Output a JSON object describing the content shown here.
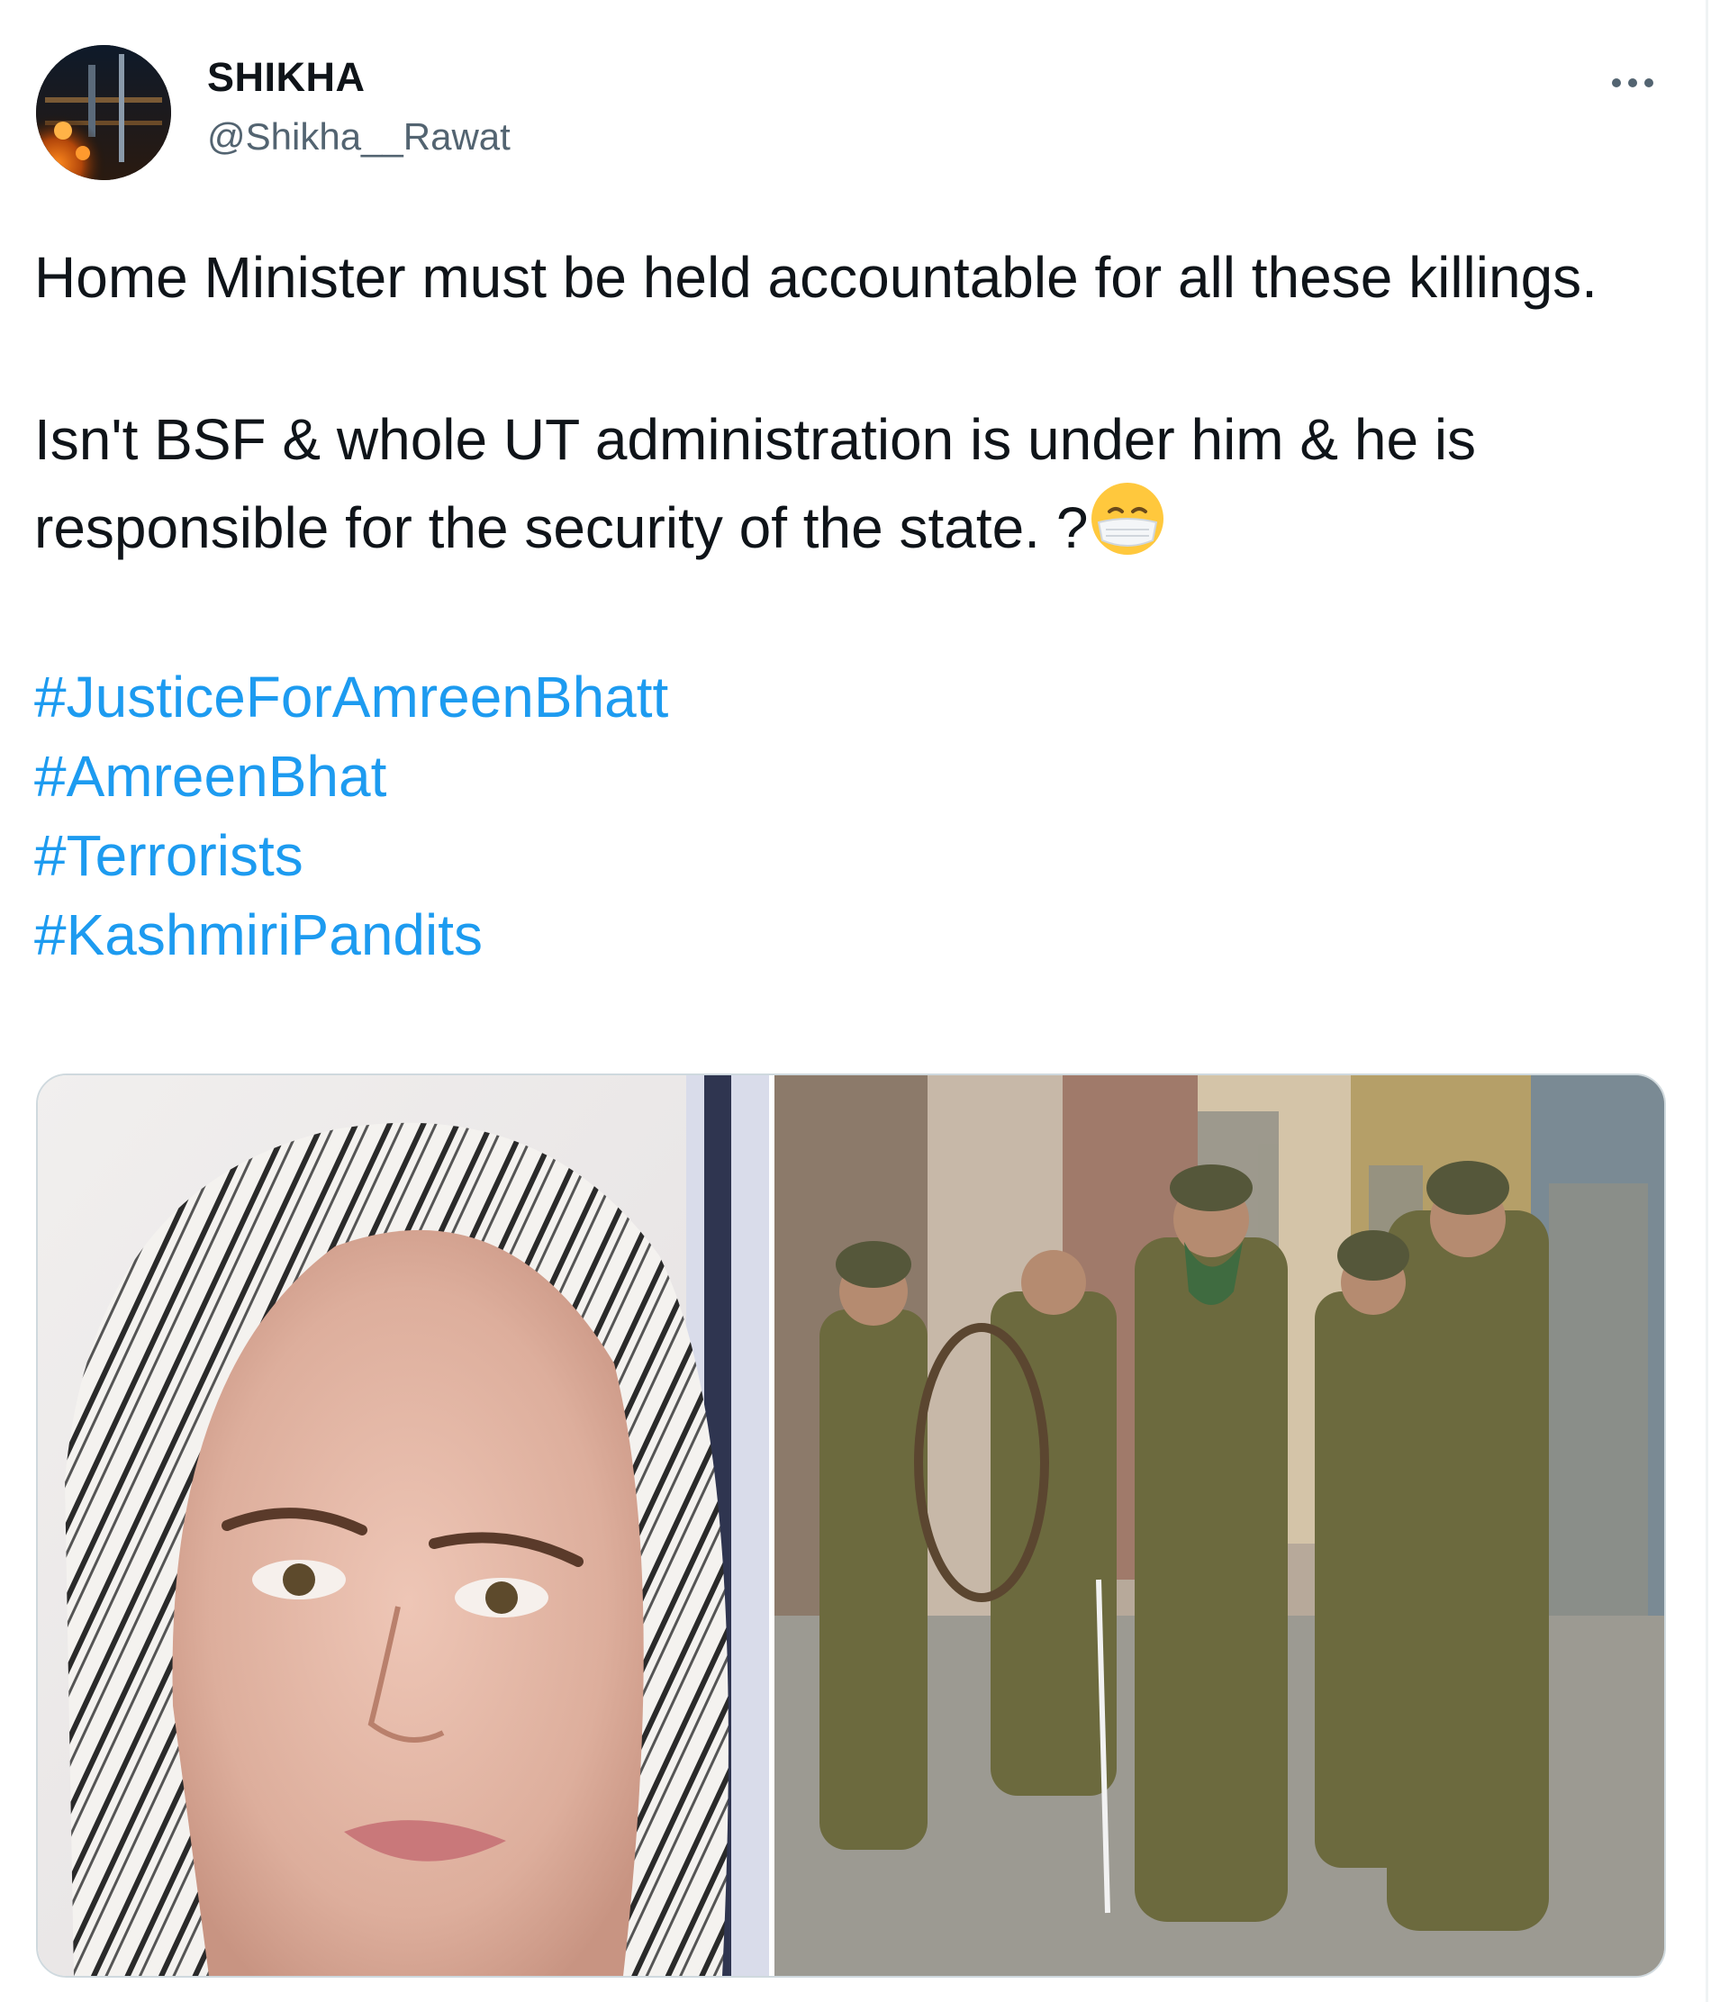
{
  "tweet": {
    "author": {
      "display_name": "SHIKHA",
      "handle": "@Shikha__Rawat"
    },
    "more_icon": "more-horizontal-icon",
    "text": {
      "paragraph_1": "Home Minister must be held accountable for all these killings.",
      "paragraph_2": "Isn't BSF & whole UT administration is under him & he is responsible for the security of the state. ?",
      "paragraph_2_emoji": "face-with-medical-mask-emoji"
    },
    "hashtags": [
      "#JusticeForAmreenBhatt",
      "#AmreenBhat",
      "#Terrorists",
      "#KashmiriPandits"
    ],
    "media": {
      "count": 2
    }
  },
  "colors": {
    "text": "#0f1419",
    "secondary_text": "#536471",
    "link": "#1d9bf0",
    "border": "#cfd9de"
  }
}
